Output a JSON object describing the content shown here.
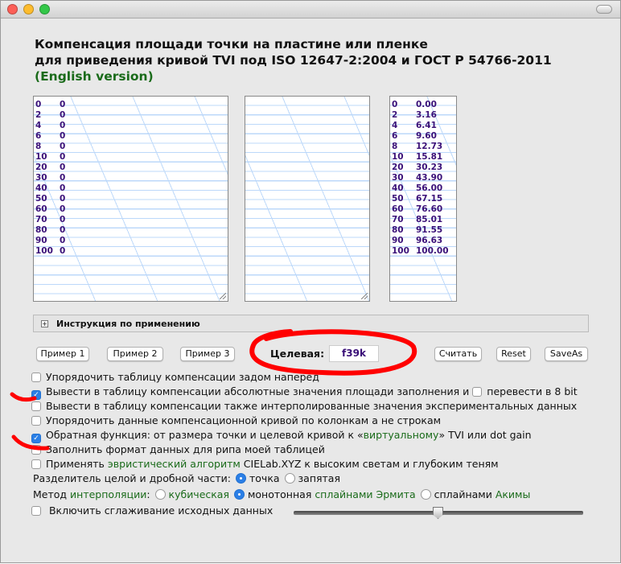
{
  "heading": {
    "line1": "Компенсация площади точки на пластине или пленке",
    "line2": "для приведения кривой TVI под ISO 12647-2:2004 и ГОСТ Р 54766-2011",
    "english": "(English version)"
  },
  "input_table": [
    [
      "0",
      "0"
    ],
    [
      "2",
      "0"
    ],
    [
      "4",
      "0"
    ],
    [
      "6",
      "0"
    ],
    [
      "8",
      "0"
    ],
    [
      "10",
      "0"
    ],
    [
      "20",
      "0"
    ],
    [
      "30",
      "0"
    ],
    [
      "40",
      "0"
    ],
    [
      "50",
      "0"
    ],
    [
      "60",
      "0"
    ],
    [
      "70",
      "0"
    ],
    [
      "80",
      "0"
    ],
    [
      "90",
      "0"
    ],
    [
      "100",
      "0"
    ]
  ],
  "output_table": [
    [
      "0",
      "0.00"
    ],
    [
      "2",
      "3.16"
    ],
    [
      "4",
      "6.41"
    ],
    [
      "6",
      "9.60"
    ],
    [
      "8",
      "12.73"
    ],
    [
      "10",
      "15.81"
    ],
    [
      "20",
      "30.23"
    ],
    [
      "30",
      "43.90"
    ],
    [
      "40",
      "56.00"
    ],
    [
      "50",
      "67.15"
    ],
    [
      "60",
      "76.60"
    ],
    [
      "70",
      "85.01"
    ],
    [
      "80",
      "91.55"
    ],
    [
      "90",
      "96.63"
    ],
    [
      "100",
      "100.00"
    ]
  ],
  "instructions": {
    "label": "Инструкция по применению",
    "expand": "+"
  },
  "buttons": {
    "ex1": "Пример 1",
    "ex2": "Пример 2",
    "ex3": "Пример 3",
    "calc": "Считать",
    "reset": "Reset",
    "saveas": "SaveAs"
  },
  "target": {
    "label": "Целевая:",
    "value": "f39k"
  },
  "options": {
    "o1": "Упорядочить таблицу компенсации задом наперед",
    "o2": "Вывести в таблицу компенсации абсолютные значения площади заполнения и",
    "o2b": "перевести в 8 bit",
    "o3": "Вывести в таблицу компенсации также интерполированные значения экспериментальных данных",
    "o4": "Упорядочить данные компенсационной кривой по колонкам а не строкам",
    "o5a": "Обратная функция: от размера точки и целевой кривой к «",
    "o5g": "виртуальному",
    "o5b": "» TVI или dot gain",
    "o6": "Заполнить формат данных для рипа моей таблицей",
    "o7a": "Применять ",
    "o7g": "эвристический алгоритм",
    "o7b": " CIELab.XYZ к высоким светам и глубоким теням",
    "sep_label": "Разделитель целой и дробной части:",
    "sep_dot": "точка",
    "sep_comma": "запятая",
    "interp_a": "Метод ",
    "interp_g": "интерполяции",
    "interp_b": ":",
    "cubic": "кубическая",
    "mono": "монотонная ",
    "mono_g": "сплайнами Эрмита",
    "akima": "сплайнами ",
    "akima_g": "Акимы",
    "smooth": "Включить сглаживание исходных данных"
  },
  "smoothing_level": 0.5,
  "colors": {
    "annotation": "#ff0000",
    "accent": "#2b7fe6",
    "green": "#1a6b1a",
    "data": "#3a1078"
  }
}
